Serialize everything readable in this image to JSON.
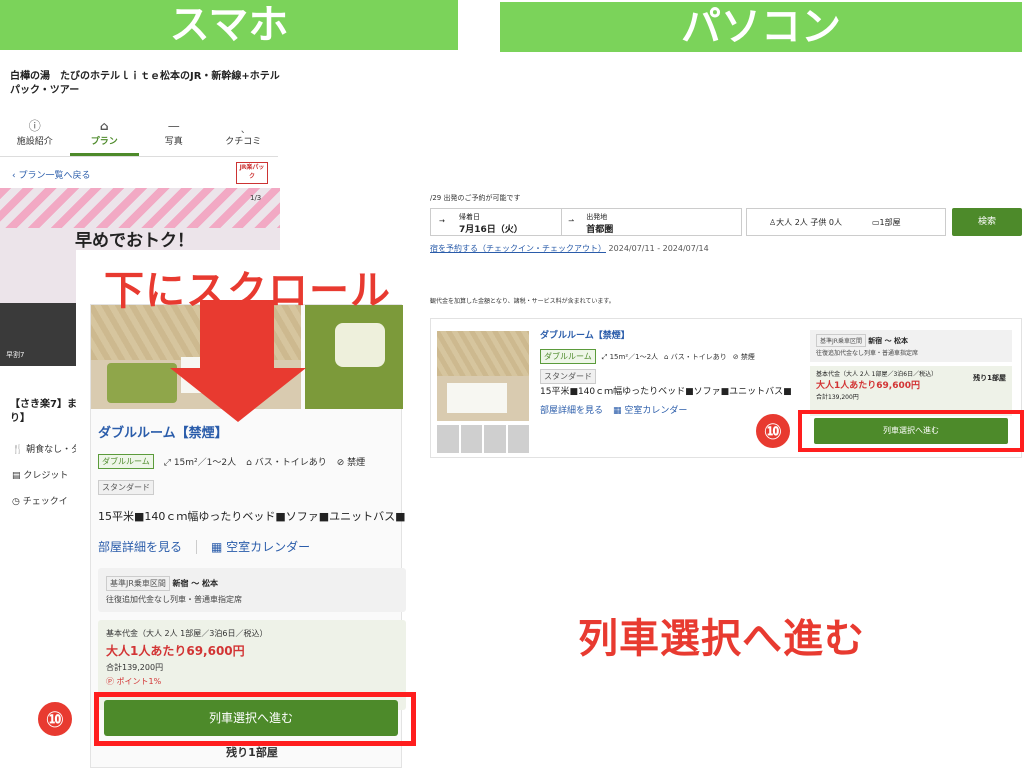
{
  "banners": {
    "mobile": "スマホ",
    "pc": "パソコン"
  },
  "mobile": {
    "hotel_name": "白樺の湯　たびのホテルｌｉｔｅ松本のJR・新幹線+ホテル パック・ツアー",
    "tabs": [
      {
        "icon": "ⓘ",
        "label": "施設紹介"
      },
      {
        "icon": "⌂",
        "label": "プラン"
      },
      {
        "icon": "—",
        "label": "写真"
      },
      {
        "icon": "ˎ",
        "label": "クチコミ"
      }
    ],
    "back_link": "プラン一覧へ戻る",
    "jr_badge": "JR楽パック",
    "photo_headline": "早めでおトク！",
    "photo_counter": "1/3",
    "photo_caption": "早割7",
    "plan_title": "【さき楽7】まり】",
    "features": [
      "朝食なし・夕",
      "クレジット",
      "チェックイ"
    ]
  },
  "card": {
    "scroll_hint": "下にスクロール",
    "room_title": "ダブルルーム【禁煙】",
    "tag_type": "ダブルルーム",
    "size": "15m²／1〜2人",
    "bath": "バス・トイレあり",
    "smoking": "禁煙",
    "tag_grade": "スタンダード",
    "description": "15平米■140ｃｍ幅ゆったりベッド■ソファ■ユニットバス■",
    "link_details": "部屋詳細を見る",
    "link_calendar": "空室カレンダー",
    "route_label": "基準JR乗車区間",
    "route": "新宿 〜 松本",
    "route_note": "往復追加代金なし列車・普通車指定席",
    "price_label": "基本代金（大人 2人 1部屋／3泊6日／税込）",
    "price_per": "大人1人あたり69,600円",
    "price_total": "合計139,200円",
    "points": "ポイント1%",
    "button": "列車選択へ進む",
    "remaining": "残り1部屋",
    "step_number": "⑩"
  },
  "desktop": {
    "availability_note": "/29 出発のご予約が可能です",
    "date_label": "帰着日",
    "date_value": "7月16日（火）",
    "depart_label": "出発地",
    "depart_value": "首都圏",
    "guests": "大人 2人 子供 0人",
    "rooms": "1部屋",
    "search_button": "検索",
    "link": "宿を予約する（チェックイン・チェックアウト）",
    "link_dates": "2024/07/11 - 2024/07/14",
    "price_note": "観代金を加算した金額となり、諸税・サービス料が含まれています。",
    "room_title": "ダブルルーム【禁煙】",
    "tag_type": "ダブルルーム",
    "size": "15m²／1〜2人",
    "bath": "バス・トイレあり",
    "smoking": "禁煙",
    "tag_grade": "スタンダード",
    "description": "15平米■140ｃｍ幅ゆったりベッド■ソファ■ユニットバス■",
    "link_details": "部屋詳細を見る",
    "link_calendar": "空室カレンダー",
    "route_label": "基準JR乗車区間",
    "route": "新宿 〜 松本",
    "route_note": "往復追加代金なし列車・普通車指定席",
    "price_label": "基本代金（大人 2人 1部屋／3泊6日／税込）",
    "price_per": "大人1人あたり69,600円",
    "price_total": "合計139,200円",
    "remaining": "残り1部屋",
    "button": "列車選択へ進む",
    "step_number": "⑩",
    "caption": "列車選択へ進む"
  }
}
